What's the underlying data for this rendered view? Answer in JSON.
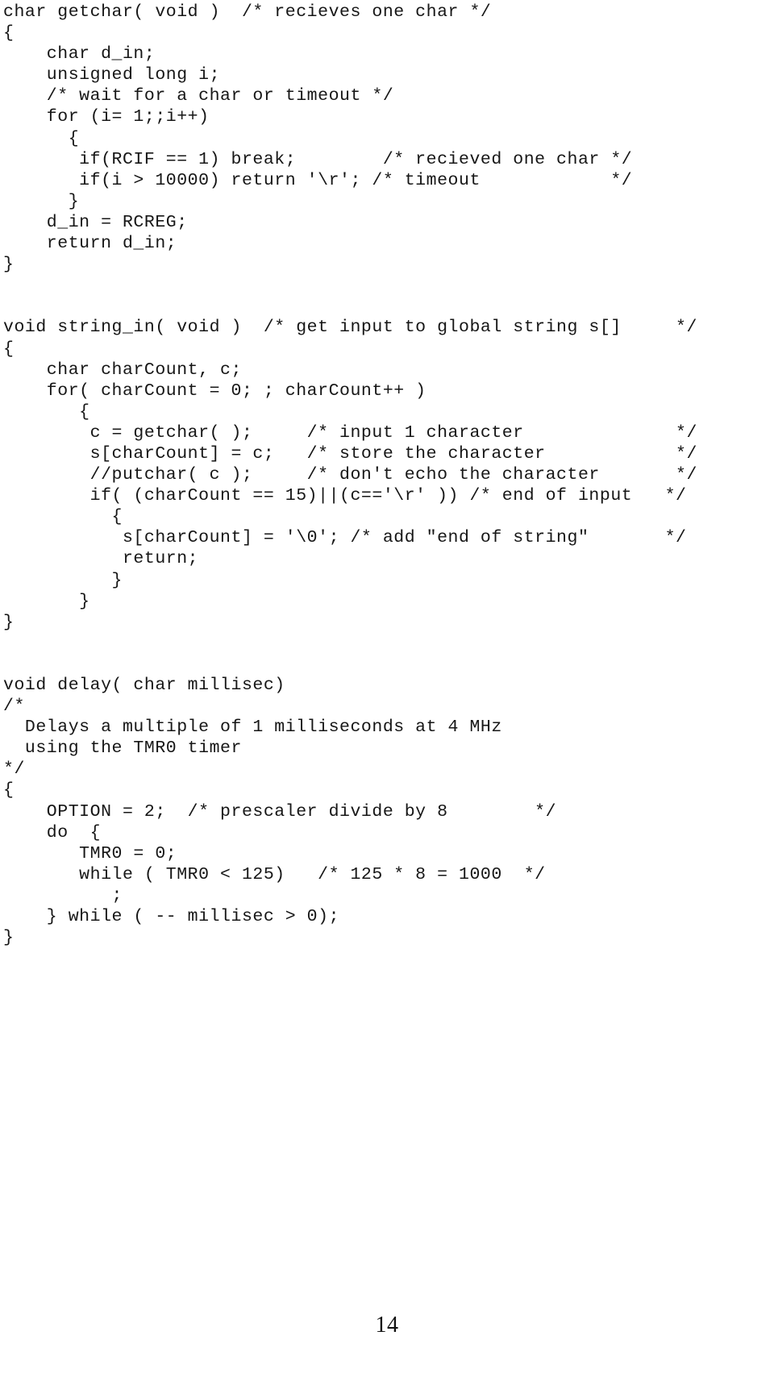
{
  "document": {
    "page_number": "14",
    "code_lines": [
      "char getchar( void )  /* recieves one char */",
      "{",
      "    char d_in;",
      "    unsigned long i;",
      "    /* wait for a char or timeout */",
      "    for (i= 1;;i++)",
      "      {",
      "       if(RCIF == 1) break;        /* recieved one char */",
      "       if(i > 10000) return '\\r'; /* timeout            */",
      "      }",
      "    d_in = RCREG;",
      "    return d_in;",
      "}",
      "",
      "",
      "void string_in( void )  /* get input to global string s[]     */",
      "{",
      "    char charCount, c;",
      "    for( charCount = 0; ; charCount++ )",
      "       {",
      "        c = getchar( );     /* input 1 character              */",
      "        s[charCount] = c;   /* store the character            */",
      "        //putchar( c );     /* don't echo the character       */",
      "        if( (charCount == 15)||(c=='\\r' )) /* end of input   */",
      "          {",
      "           s[charCount] = '\\0'; /* add \"end of string\"       */",
      "           return;",
      "          }",
      "       }",
      "}",
      "",
      "",
      "void delay( char millisec)",
      "/*",
      "  Delays a multiple of 1 milliseconds at 4 MHz",
      "  using the TMR0 timer",
      "*/",
      "{",
      "    OPTION = 2;  /* prescaler divide by 8        */",
      "    do  {",
      "       TMR0 = 0;",
      "       while ( TMR0 < 125)   /* 125 * 8 = 1000  */",
      "          ;",
      "    } while ( -- millisec > 0);",
      "}"
    ]
  }
}
